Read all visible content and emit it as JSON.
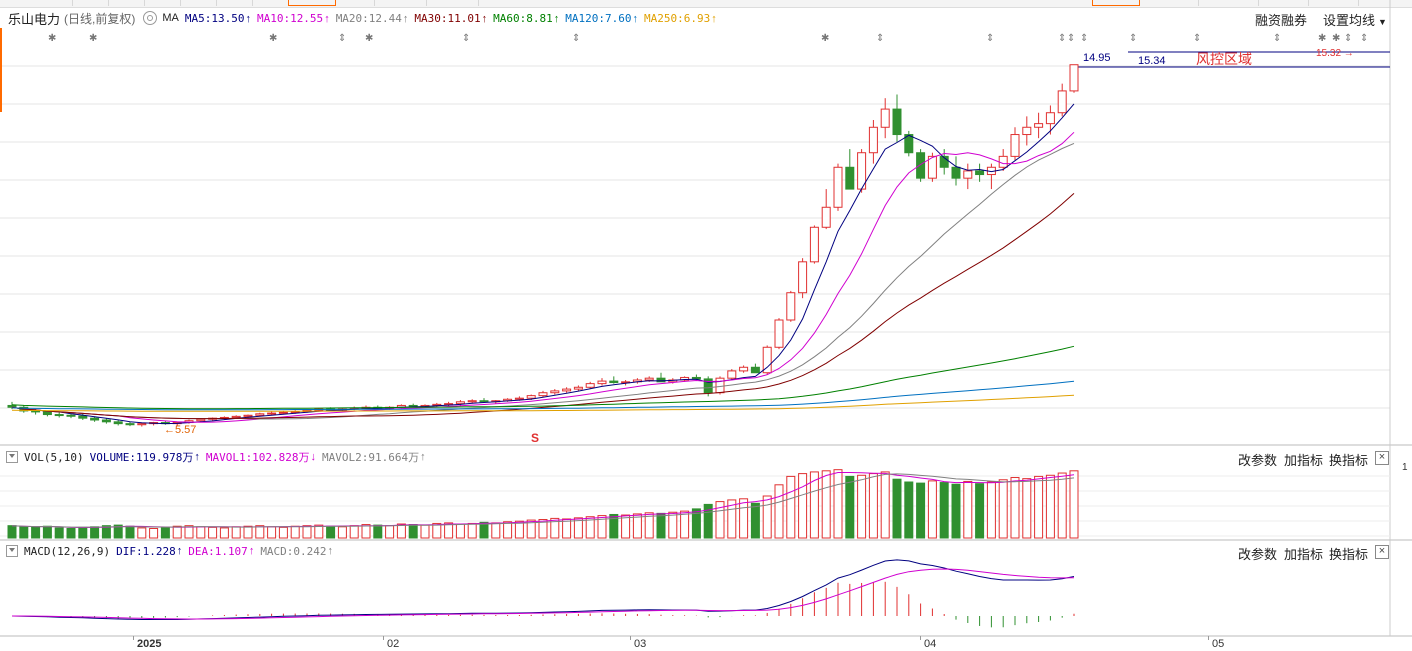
{
  "stock": {
    "name": "乐山电力",
    "mode": "(日线,前复权)"
  },
  "ma_legend": {
    "label": "MA",
    "items": [
      {
        "name": "MA5",
        "value": "13.50",
        "color": "#000080",
        "arrow": "↑"
      },
      {
        "name": "MA10",
        "value": "12.55",
        "color": "#d000d0",
        "arrow": "↑"
      },
      {
        "name": "MA20",
        "value": "12.44",
        "color": "#808080",
        "arrow": "↑"
      },
      {
        "name": "MA30",
        "value": "11.01",
        "color": "#800000",
        "arrow": "↑"
      },
      {
        "name": "MA60",
        "value": "8.81",
        "color": "#008000",
        "arrow": "↑"
      },
      {
        "name": "MA120",
        "value": "7.60",
        "color": "#0070c0",
        "arrow": "↑"
      },
      {
        "name": "MA250",
        "value": "6.93",
        "color": "#e0a000",
        "arrow": "↑"
      }
    ]
  },
  "toolbar": {
    "margin_label": "融资融券",
    "ma_settings_label": "设置均线"
  },
  "annotations": {
    "low_price": "5.57",
    "risk_zone_label": "风控区域",
    "risk_low": "14.95",
    "risk_high": "15.34",
    "last_high": "15.32",
    "signal_marker": "S",
    "right_axis_tick": "1"
  },
  "volume_panel": {
    "title": "VOL(5,10)",
    "volume": "VOLUME:119.978万",
    "volume_arrow": "↑",
    "mavol1": "MAVOL1:102.828万",
    "mavol1_arrow": "↓",
    "mavol2": "MAVOL2:91.664万",
    "mavol2_arrow": "↑",
    "btn_params": "改参数",
    "btn_add": "加指标",
    "btn_switch": "换指标",
    "btn_close": "×"
  },
  "macd_panel": {
    "title": "MACD(12,26,9)",
    "dif": "DIF:1.228",
    "dif_arrow": "↑",
    "dea": "DEA:1.107",
    "dea_arrow": "↑",
    "macd": "MACD:0.242",
    "macd_arrow": "↑",
    "btn_params": "改参数",
    "btn_add": "加指标",
    "btn_switch": "换指标",
    "btn_close": "×"
  },
  "x_axis": {
    "labels": [
      "2025",
      "02",
      "03",
      "04",
      "05"
    ]
  },
  "colors": {
    "up": "#e03030",
    "down": "#309030",
    "grid": "#d8d8d8",
    "accent": "#ff6a00"
  },
  "chart_data": {
    "type": "candlestick",
    "title": "乐山电力 (日线,前复权)",
    "ohlc": [
      [
        5.95,
        6.05,
        5.85,
        5.9
      ],
      [
        5.9,
        5.95,
        5.75,
        5.8
      ],
      [
        5.8,
        5.85,
        5.7,
        5.78
      ],
      [
        5.78,
        5.8,
        5.65,
        5.7
      ],
      [
        5.7,
        5.78,
        5.62,
        5.68
      ],
      [
        5.68,
        5.75,
        5.6,
        5.66
      ],
      [
        5.66,
        5.72,
        5.55,
        5.6
      ],
      [
        5.6,
        5.65,
        5.5,
        5.55
      ],
      [
        5.55,
        5.6,
        5.45,
        5.5
      ],
      [
        5.5,
        5.55,
        5.4,
        5.45
      ],
      [
        5.45,
        5.5,
        5.38,
        5.42
      ],
      [
        5.42,
        5.48,
        5.37,
        5.45
      ],
      [
        5.45,
        5.5,
        5.4,
        5.48
      ],
      [
        5.48,
        5.52,
        5.42,
        5.45
      ],
      [
        5.45,
        5.5,
        5.4,
        5.48
      ],
      [
        5.48,
        5.56,
        5.45,
        5.53
      ],
      [
        5.53,
        5.6,
        5.5,
        5.57
      ],
      [
        5.57,
        5.62,
        5.52,
        5.6
      ],
      [
        5.6,
        5.65,
        5.55,
        5.62
      ],
      [
        5.62,
        5.68,
        5.58,
        5.65
      ],
      [
        5.65,
        5.7,
        5.6,
        5.68
      ],
      [
        5.68,
        5.75,
        5.65,
        5.72
      ],
      [
        5.72,
        5.78,
        5.68,
        5.74
      ],
      [
        5.74,
        5.8,
        5.7,
        5.76
      ],
      [
        5.76,
        5.82,
        5.72,
        5.78
      ],
      [
        5.78,
        5.85,
        5.75,
        5.82
      ],
      [
        5.82,
        5.88,
        5.78,
        5.85
      ],
      [
        5.85,
        5.9,
        5.8,
        5.83
      ],
      [
        5.83,
        5.88,
        5.78,
        5.85
      ],
      [
        5.85,
        5.92,
        5.82,
        5.88
      ],
      [
        5.88,
        5.95,
        5.85,
        5.9
      ],
      [
        5.9,
        5.95,
        5.85,
        5.88
      ],
      [
        5.88,
        5.93,
        5.83,
        5.9
      ],
      [
        5.9,
        5.98,
        5.87,
        5.95
      ],
      [
        5.95,
        6.0,
        5.9,
        5.92
      ],
      [
        5.92,
        5.98,
        5.88,
        5.95
      ],
      [
        5.95,
        6.02,
        5.9,
        5.98
      ],
      [
        5.98,
        6.05,
        5.93,
        6.0
      ],
      [
        6.0,
        6.1,
        5.95,
        6.05
      ],
      [
        6.05,
        6.12,
        6.0,
        6.08
      ],
      [
        6.08,
        6.15,
        6.02,
        6.05
      ],
      [
        6.05,
        6.1,
        6.0,
        6.08
      ],
      [
        6.08,
        6.15,
        6.05,
        6.12
      ],
      [
        6.12,
        6.2,
        6.08,
        6.15
      ],
      [
        6.15,
        6.25,
        6.1,
        6.22
      ],
      [
        6.22,
        6.35,
        6.18,
        6.3
      ],
      [
        6.3,
        6.4,
        6.25,
        6.35
      ],
      [
        6.35,
        6.45,
        6.3,
        6.4
      ],
      [
        6.4,
        6.5,
        6.35,
        6.45
      ],
      [
        6.45,
        6.6,
        6.4,
        6.55
      ],
      [
        6.55,
        6.7,
        6.5,
        6.62
      ],
      [
        6.62,
        6.75,
        6.55,
        6.58
      ],
      [
        6.58,
        6.65,
        6.5,
        6.6
      ],
      [
        6.6,
        6.7,
        6.55,
        6.65
      ],
      [
        6.65,
        6.75,
        6.6,
        6.7
      ],
      [
        6.7,
        6.85,
        6.65,
        6.6
      ],
      [
        6.6,
        6.7,
        6.55,
        6.65
      ],
      [
        6.65,
        6.75,
        6.6,
        6.72
      ],
      [
        6.72,
        6.8,
        6.65,
        6.68
      ],
      [
        6.68,
        6.75,
        6.2,
        6.3
      ],
      [
        6.3,
        6.75,
        6.25,
        6.7
      ],
      [
        6.7,
        6.95,
        6.65,
        6.9
      ],
      [
        6.9,
        7.05,
        6.85,
        7.0
      ],
      [
        7.0,
        7.1,
        6.95,
        6.85
      ],
      [
        6.85,
        7.6,
        6.8,
        7.55
      ],
      [
        7.55,
        8.35,
        7.5,
        8.3
      ],
      [
        8.3,
        9.1,
        8.25,
        9.05
      ],
      [
        9.05,
        10.0,
        8.9,
        9.9
      ],
      [
        9.9,
        10.9,
        9.85,
        10.85
      ],
      [
        10.85,
        11.9,
        10.8,
        11.4
      ],
      [
        11.4,
        12.6,
        11.3,
        12.5
      ],
      [
        12.5,
        13.0,
        12.3,
        11.9
      ],
      [
        11.9,
        13.0,
        11.8,
        12.9
      ],
      [
        12.9,
        13.8,
        12.6,
        13.6
      ],
      [
        13.6,
        14.4,
        13.3,
        14.1
      ],
      [
        14.1,
        14.5,
        13.2,
        13.4
      ],
      [
        13.4,
        13.5,
        12.8,
        12.9
      ],
      [
        12.9,
        13.0,
        12.1,
        12.2
      ],
      [
        12.2,
        12.9,
        12.1,
        12.8
      ],
      [
        12.8,
        13.0,
        12.3,
        12.5
      ],
      [
        12.5,
        12.8,
        12.0,
        12.2
      ],
      [
        12.2,
        12.6,
        11.9,
        12.4
      ],
      [
        12.4,
        12.6,
        12.1,
        12.3
      ],
      [
        12.3,
        12.6,
        11.9,
        12.5
      ],
      [
        12.5,
        13.0,
        12.4,
        12.8
      ],
      [
        12.8,
        13.6,
        12.7,
        13.4
      ],
      [
        13.4,
        13.9,
        13.1,
        13.6
      ],
      [
        13.6,
        14.0,
        13.3,
        13.7
      ],
      [
        13.7,
        14.2,
        13.4,
        14.0
      ],
      [
        14.0,
        14.8,
        13.9,
        14.6
      ],
      [
        14.6,
        15.32,
        14.55,
        15.32
      ]
    ],
    "volume": [
      22,
      20,
      19,
      21,
      18,
      17,
      19,
      20,
      22,
      23,
      21,
      18,
      17,
      19,
      21,
      22,
      20,
      19,
      18,
      20,
      21,
      22,
      20,
      19,
      21,
      22,
      23,
      21,
      20,
      22,
      24,
      23,
      22,
      25,
      24,
      23,
      26,
      27,
      25,
      26,
      28,
      27,
      29,
      30,
      32,
      33,
      35,
      34,
      36,
      38,
      40,
      42,
      41,
      43,
      45,
      44,
      46,
      48,
      52,
      60,
      65,
      68,
      70,
      62,
      75,
      95,
      110,
      115,
      118,
      120,
      122,
      110,
      112,
      115,
      118,
      105,
      100,
      98,
      102,
      99,
      96,
      101,
      97,
      100,
      104,
      108,
      106,
      110,
      112,
      116,
      119.978
    ],
    "macd": {
      "dif_last": 1.228,
      "dea_last": 1.107,
      "macd_last": 0.242
    },
    "x_labels": [
      "2025",
      "02",
      "03",
      "04",
      "05"
    ],
    "ylabel": "",
    "risk_zone": [
      14.95,
      15.34
    ]
  }
}
